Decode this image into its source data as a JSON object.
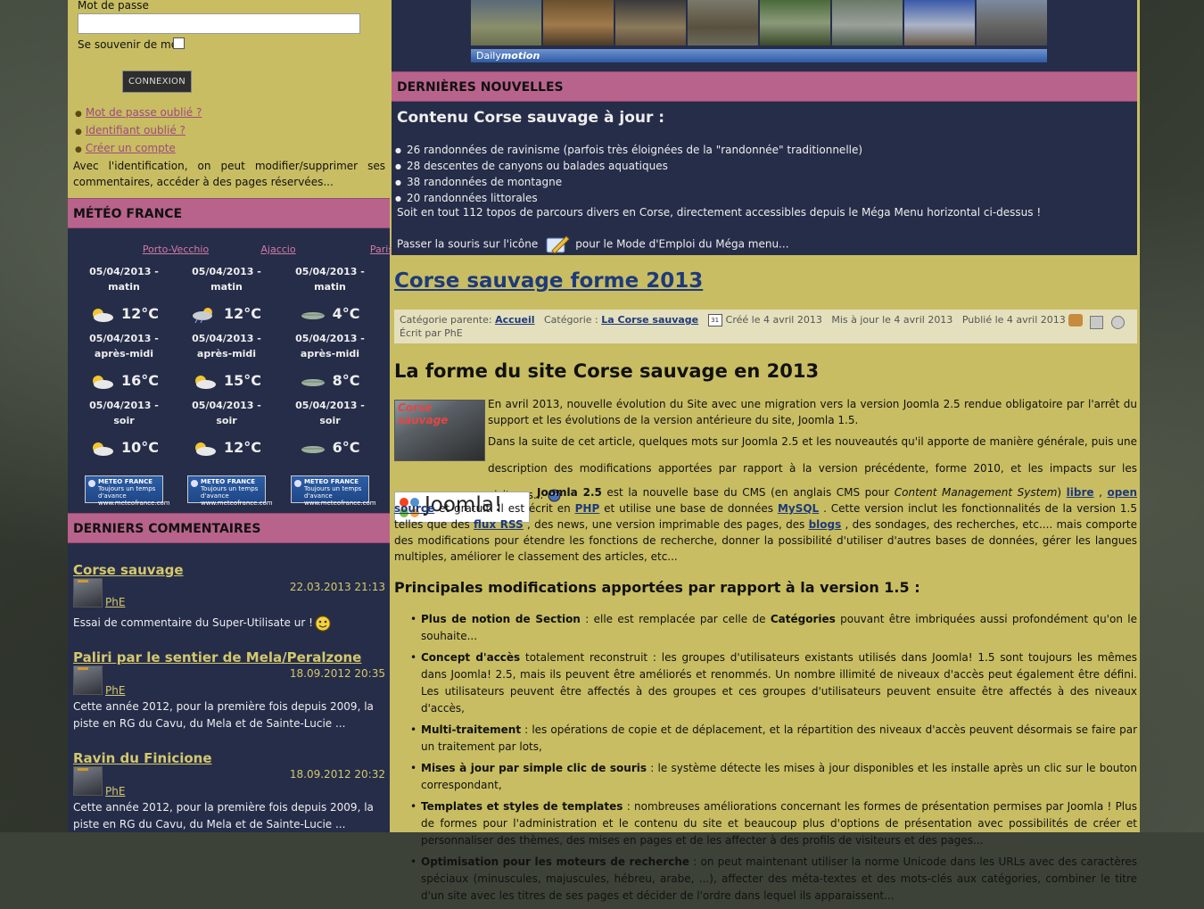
{
  "login": {
    "password_label": "Mot de passe",
    "remember_label": "Se souvenir de moi",
    "login_button": "CONNEXION",
    "links": [
      "Mot de passe oublié ?",
      "Identifiant oublié ?",
      "Créer un compte"
    ],
    "info_text": "Avec l'identification, on peut modifier/supprimer ses commentaires, accéder à des pages réservées..."
  },
  "meteo": {
    "title": "MÉTÉO FRANCE",
    "cities": [
      {
        "name": "Porto-Vecchio",
        "slots": [
          {
            "date": "05/04/2013 -",
            "period": "matin",
            "temp": "12°C",
            "icon": "sun-cloud-icon"
          },
          {
            "date": "05/04/2013 -",
            "period": "après-midi",
            "temp": "16°C",
            "icon": "sun-cloud-icon"
          },
          {
            "date": "05/04/2013 -",
            "period": "soir",
            "temp": "10°C",
            "icon": "sun-cloud-icon"
          }
        ]
      },
      {
        "name": "Ajaccio",
        "slots": [
          {
            "date": "05/04/2013 -",
            "period": "matin",
            "temp": "12°C",
            "icon": "rain-sun-icon"
          },
          {
            "date": "05/04/2013 -",
            "period": "après-midi",
            "temp": "15°C",
            "icon": "sun-cloud-icon"
          },
          {
            "date": "05/04/2013 -",
            "period": "soir",
            "temp": "12°C",
            "icon": "sun-cloud-icon"
          }
        ]
      },
      {
        "name": "Paris",
        "slots": [
          {
            "date": "05/04/2013 -",
            "period": "matin",
            "temp": "4°C",
            "icon": "wind-cloud-icon"
          },
          {
            "date": "05/04/2013 -",
            "period": "après-midi",
            "temp": "8°C",
            "icon": "wind-cloud-icon"
          },
          {
            "date": "05/04/2013 -",
            "period": "soir",
            "temp": "6°C",
            "icon": "wind-cloud-icon"
          }
        ]
      }
    ],
    "logo_line1": "METEO FRANCE",
    "logo_line2": "Toujours un temps d'avance",
    "logo_line3": "www.meteofrance.com"
  },
  "comments": {
    "title": "DERNIERS COMMENTAIRES",
    "items": [
      {
        "title": "Corse sauvage",
        "date": "22.03.2013 21:13",
        "author": "PhE",
        "text": "Essai de commentaire du Super-Utilisate ur !"
      },
      {
        "title": "Paliri par le sentier de Mela/Peralzone",
        "date": "18.09.2012 20:35",
        "author": "PhE",
        "text": "Cette année 2012, pour la première fois depuis 2009, la piste en RG du Cavu, du Mela et de Sainte-Lucie ..."
      },
      {
        "title": "Ravin du Finicione",
        "date": "18.09.2012 20:32",
        "author": "PhE",
        "text": "Cette année 2012, pour la première fois depuis 2009, la piste en RG du Cavu, du Mela et de Sainte-Lucie ..."
      }
    ]
  },
  "video": {
    "brand": "Daily",
    "brand_italic": "motion"
  },
  "news": {
    "band_title": "DERNIÈRES NOUVELLES",
    "heading": "Contenu Corse sauvage à jour :",
    "items": [
      "26 randonnées de ravinisme (parfois très éloignées de la \"randonnée\" traditionnelle)",
      "28 descentes de canyons ou balades aquatiques",
      "38 randonnées de montagne",
      "20 randonnées littorales"
    ],
    "summary": "Soit en tout 112 topos de parcours divers en Corse, directement accessibles depuis le Méga Menu horizontal ci-dessus !",
    "megamenu_before": "Passer la souris sur l'icône",
    "megamenu_after": "pour le Mode d'Emploi du Méga menu..."
  },
  "article": {
    "title": "Corse sauvage forme 2013",
    "meta": {
      "parent_label": "Catégorie parente:",
      "parent_link": "Accueil",
      "category_label": "Catégorie :",
      "category_link": "La Corse sauvage",
      "created": "Créé le 4 avril 2013",
      "updated": "Mis à jour le 4 avril 2013",
      "published": "Publié le 4 avril 2013",
      "author": "Écrit par PhE"
    },
    "h2": "La forme du site Corse sauvage en 2013",
    "image_caption": "Corse sauvage",
    "p1": "En avril 2013, nouvelle évolution du Site avec une migration vers la version Joomla 2.5 rendue obligatoire par l'arrêt du support et les évolutions de la version antérieure du site, Joomla 1.5.",
    "p2": "Dans la suite de cet article, quelques mots sur Joomla 2.5 et les nouveautés qu'il apporte de manière générale, puis une description des modifications apportées par rapport à la version précédente, forme 2010, et les impacts sur les visiteurs...",
    "joomla_logo_text": "Joomla!",
    "joomla_para": {
      "lead": "Joomla 2.5",
      "t1": " est la nouvelle base du CMS (en anglais CMS pour ",
      "cms": "Content Management System",
      "t2": ") ",
      "libre": "libre",
      "t3": " , ",
      "opensource": "open source",
      "t4": " et gratuit. Il est écrit en ",
      "php": "PHP",
      "t5": " et utilise une base de données ",
      "mysql": "MySQL",
      "t6": " . Cette version inclut les fonctionnalités de la version 1.5 telles que des ",
      "rss": "flux RSS",
      "t7": " , des news, une version imprimable des pages, des ",
      "blogs": "blogs",
      "t8": " , des sondages, des recherches, etc.... mais comporte des modifications pour étendre les fonctions de recherche, donner la possibilité d'utiliser d'autres bases de données, gérer les langues multiples, améliorer le classement des articles, etc..."
    },
    "h3": "Principales modifications apportées par rapport à la version 1.5 :",
    "mods": [
      {
        "lead": "Plus de notion de Section",
        "text": " : elle est remplacée par celle de ",
        "bold2": "Catégories",
        "text2": " pouvant être imbriquées aussi profondément qu'on le souhaite..."
      },
      {
        "lead": "Concept d'accès",
        "text": " totalement reconstruit : les groupes d'utilisateurs existants utilisés dans Joomla! 1.5 sont toujours les mêmes dans Joomla! 2.5, mais ils peuvent être améliorés et renommés. Un nombre illimité de niveaux d'accès peut également être défini. Les utilisateurs peuvent être affectés à des groupes et ces groupes d'utilisateurs peuvent ensuite être affectés à des niveaux d'accès,",
        "bold2": "",
        "text2": ""
      },
      {
        "lead": "Multi-traitement",
        "text": " : les opérations de copie et de déplacement, et la répartition des niveaux d'accès peuvent désormais se faire par un traitement par lots,",
        "bold2": "",
        "text2": ""
      },
      {
        "lead": "Mises à jour par simple clic de souris",
        "text": " : le système détecte les mises à jour disponibles et les installe après un clic sur le bouton correspondant,",
        "bold2": "",
        "text2": ""
      },
      {
        "lead": "Templates et styles de templates",
        "text": " : nombreuses améliorations concernant les formes de présentation permises par Joomla ! Plus de formes pour l'administration et le contenu du site et beaucoup plus d'options de présentation avec possibilités de créer et personnaliser des thèmes, des mises en pages et de les affecter à des profils de visiteurs et des pages...",
        "bold2": "",
        "text2": ""
      },
      {
        "lead": "Optimisation pour les moteurs de recherche",
        "text": " : on peut maintenant utiliser la norme Unicode dans les URLs avec des caractères spéciaux (minuscules, majuscules, hébreu, arabe, ...), affecter des méta-textes et des mots-clés aux catégories, combiner le titre d'un site avec les titres de ses pages et décider de l'ordre dans lequel ils apparaissent...",
        "bold2": "",
        "text2": ""
      }
    ]
  }
}
